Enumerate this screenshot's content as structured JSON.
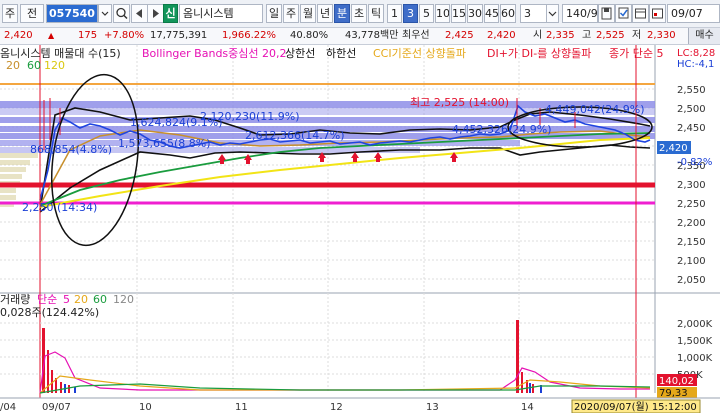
{
  "toolbar": {
    "menu_label": "주",
    "mode_label": "전",
    "stock_code": "057540",
    "credit_badge": "신",
    "stock_name": "옴니시스템",
    "periods": [
      "일",
      "주",
      "월",
      "년",
      "분",
      "초",
      "틱"
    ],
    "active_period": "분",
    "intervals": [
      "1",
      "3",
      "5",
      "10",
      "15",
      "30",
      "45",
      "60"
    ],
    "active_interval": "3",
    "interval_select": "3",
    "count_display": "140/900",
    "date_display": "09/07"
  },
  "quote": {
    "price": "2,420",
    "change": "175",
    "change_pct": "+7.80%",
    "volume": "17,775,391",
    "volume_ratio": "1,966.22%",
    "turnover_ratio": "40.80%",
    "amount": "43,778백만",
    "best_ask_label": "최우선",
    "best_ask": "2,425",
    "best_bid": "2,420",
    "open_label": "시",
    "open": "2,335",
    "high_label": "고",
    "high": "2,525",
    "low_label": "저",
    "low": "2,330",
    "sell_button": "매수"
  },
  "price_legend": {
    "item1": "옴니시스템 매물대 수(15)",
    "item2": "Bollinger Bands중심선 20,2",
    "item3": "상한선",
    "item4": "하한선",
    "item5": "CCI기준선 상향돌파",
    "item6": "DI+가 DI-를 상향돌파",
    "item7": "종가 단순 5",
    "ma_periods": [
      "20",
      "60",
      "120"
    ],
    "right_note1": "LC:8,28",
    "right_note2": "HC:-4,1"
  },
  "price_axis": {
    "ticks": [
      "2,550",
      "2,500",
      "2,450",
      "2,400",
      "2,350",
      "2,300",
      "2,250",
      "2,200",
      "2,150",
      "2,100",
      "2,050"
    ],
    "current_price": "2,420",
    "current_change": "-0.82%"
  },
  "annotations": {
    "high_label": "최고 2,525 (14:00)",
    "profile1": "2,120,230(11.9%)",
    "profile2": "1,624,824(9.1%)",
    "profile3": "4,452,326(24.9%)",
    "profile4": "4,449,042(24.9%)",
    "profile5": "2,612,366(14.7%)",
    "profile6": "1,573,655(8.8%)",
    "profile7": "868,854(4.8%)",
    "low_label": "2,250 (14:34)"
  },
  "volume_legend": {
    "label": "거래량",
    "ma_label": "단순",
    "ma_periods": [
      "5",
      "20",
      "60",
      "120"
    ],
    "value_text": "0,028주(124.42%)"
  },
  "volume_axis": {
    "ticks": [
      "2,000K",
      "1,500K",
      "1,000K",
      "500K"
    ],
    "current_volume": "140,02",
    "current_ma": "79,33"
  },
  "time_axis": {
    "labels": [
      "/04",
      "09/07",
      "10",
      "11",
      "12",
      "13",
      "14"
    ],
    "crosshair_label": "2020/09/07(월) 15:12:00"
  }
}
